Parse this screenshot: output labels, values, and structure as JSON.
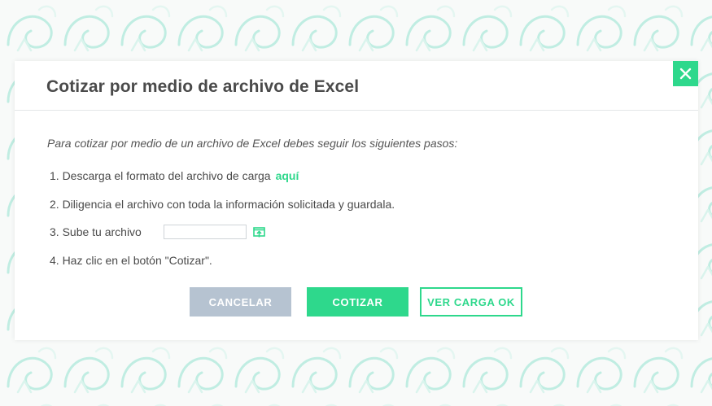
{
  "colors": {
    "accent": "#2ed88c",
    "cancel_button": "#b6c3d1",
    "title_text": "#4a4a4a",
    "background_pattern": "#8ee0d0"
  },
  "modal": {
    "title": "Cotizar por medio de archivo de Excel",
    "close_icon": "close-icon",
    "intro": "Para cotizar por medio de un archivo de Excel debes seguir los siguientes pasos:",
    "steps": {
      "step1": "1. Descarga el formato del archivo de carga",
      "step1_link": "aquí",
      "step2": "2. Diligencia el archivo con toda la información solicitada y guardala.",
      "step3": "3. Sube tu archivo",
      "step3_file_value": "",
      "step3_upload_icon": "upload-icon",
      "step4": "4. Haz clic en el botón \"Cotizar\"."
    },
    "buttons": {
      "cancel": "CANCELAR",
      "quote": "COTIZAR",
      "view_ok": "VER CARGA OK"
    }
  }
}
